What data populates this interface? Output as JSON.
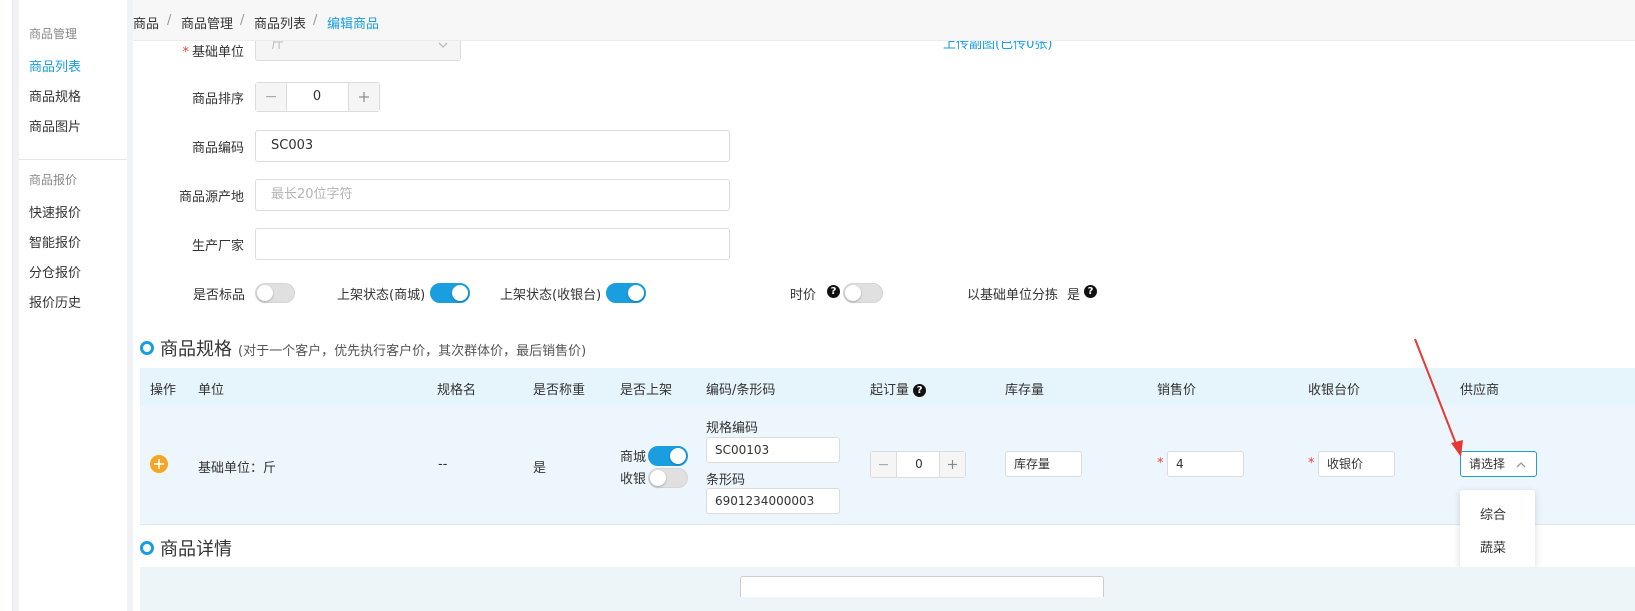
{
  "sidebar": {
    "group1": "商品管理",
    "items1": [
      "商品列表",
      "商品规格",
      "商品图片"
    ],
    "group2": "商品报价",
    "items2": [
      "快速报价",
      "智能报价",
      "分仓报价",
      "报价历史"
    ]
  },
  "breadcrumb": [
    "商品",
    "商品管理",
    "商品列表",
    "编辑商品"
  ],
  "breadcrumb_sep": "/",
  "form": {
    "base_unit_label": "基础单位",
    "base_unit_value": "斤",
    "upload_link": "上传副图(已传0张)",
    "sort_label": "商品排序",
    "sort_value": "0",
    "code_label": "商品编码",
    "code_value": "SC003",
    "origin_label": "商品源产地",
    "origin_placeholder": "最长20位字符",
    "maker_label": "生产厂家",
    "maker_value": "",
    "std_label": "是否标品",
    "mall_label": "上架状态(商城)",
    "pos_label": "上架状态(收银台)",
    "price_time_label": "时价",
    "sort_by_base_label": "以基础单位分拣",
    "sort_by_base_value": "是"
  },
  "spec_section": {
    "title": "商品规格",
    "subtitle": "(对于一个客户，优先执行客户价，其次群体价，最后销售价)",
    "columns": [
      "操作",
      "单位",
      "规格名",
      "是否称重",
      "是否上架",
      "编码/条形码",
      "起订量",
      "库存量",
      "销售价",
      "收银台价",
      "供应商"
    ],
    "row": {
      "unit": "基础单位：斤",
      "spec_name": "--",
      "weighing": "是",
      "mall": "商城",
      "pos": "收银",
      "spec_code_label": "规格编码",
      "spec_code_value": "SC00103",
      "barcode_label": "条形码",
      "barcode_value": "6901234000003",
      "min_order": "0",
      "stock_placeholder": "库存量",
      "sale_price": "4",
      "pos_price_placeholder": "收银价",
      "supplier_placeholder": "请选择"
    },
    "supplier_options": [
      "综合",
      "蔬菜"
    ]
  },
  "detail_section": {
    "title": "商品详情"
  },
  "colors": {
    "accent": "#1a9ee0",
    "required": "#f04134",
    "add_button": "#f5a623",
    "arrow": "#e53935"
  },
  "icons": [
    "chevron-down-icon",
    "minus-icon",
    "plus-icon",
    "question-icon",
    "add-circle-icon",
    "chevron-up-icon",
    "red-arrow-annotation"
  ]
}
